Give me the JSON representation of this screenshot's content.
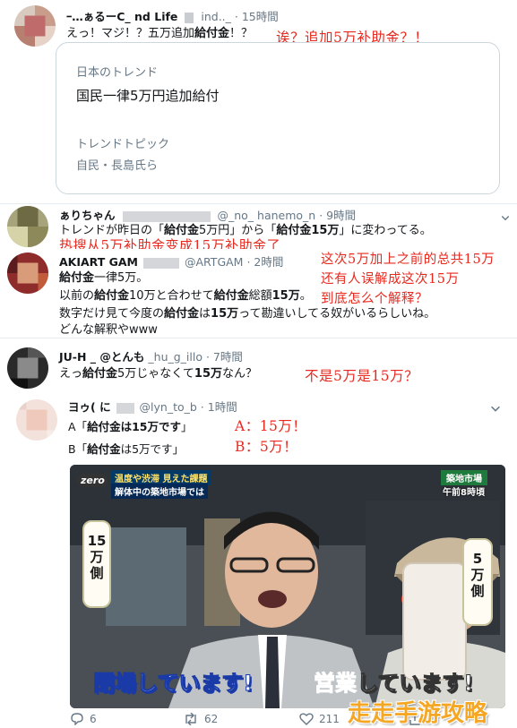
{
  "tweet1": {
    "username": "ｰ…ぁるーC_ nd Life",
    "handle": "ind.._",
    "time": "15時間",
    "text_prefix": "えっ！マジ！？五万追加",
    "text_bold": "給付金",
    "text_suffix": "！？",
    "note": "诶？追加5万补助金？！"
  },
  "trend_card": {
    "label": "日本のトレンド",
    "title": "国民一律5万円追加給付",
    "topic_label": "トレンドトピック",
    "topic_value": "自民・長島氏ら"
  },
  "tweet2": {
    "username": "ぁりちゃん",
    "handle": "@_no_ hanemo_n",
    "time": "9時間",
    "line1_a": "トレンドが昨日の「",
    "line1_b": "給付金",
    "line1_c": "5万円」から「",
    "line1_d": "給付金15万",
    "line1_e": "」に変わってる。",
    "note": "热搜从5万补助金变成15万补助金了"
  },
  "tweet3": {
    "username": "AKIART GAM",
    "handle": "@ARTGAM",
    "time": "2時間",
    "line1_bold": "給付金",
    "line1_rest": "一律5万。",
    "line2_a": "以前の",
    "line2_b": "給付金",
    "line2_c": "10万と合わせて",
    "line2_d": "給付金",
    "line2_e": "総額",
    "line2_f": "15万",
    "line2_g": "。",
    "line3_a": "数字だけ見て今度の",
    "line3_b": "給付金",
    "line3_c": "は",
    "line3_d": "15万",
    "line3_e": "って勘違いしてる奴がいるらしいね。",
    "line4": "どんな解釈やwww",
    "note1": "这次5万加上之前的总共15万",
    "note2": "还有人误解成这次15万",
    "note3": "到底怎么个解释？"
  },
  "tweet4": {
    "username": "JU-H _ @とんも",
    "handle": "_hu_g_illo",
    "time": "7時間",
    "text_a": "えっ",
    "text_b": "給付金",
    "text_c": "5万じゃなくて",
    "text_d": "15万",
    "text_e": "なん？",
    "note": "不是5万是15万？"
  },
  "tweet5": {
    "username": "ヨゥ( に",
    "handle": "@lyn_to_b",
    "time": "1時間",
    "line_a_prefix": "A「",
    "line_a_bold": "給付金は15万です",
    "line_a_suffix": "」",
    "line_b_prefix": "B「",
    "line_b_bold": "給付金",
    "line_b_suffix": "は5万です」",
    "note_a": "A：15万！",
    "note_b": "B：5万！",
    "actions": {
      "reply": "6",
      "retweet": "62",
      "like": "211"
    }
  },
  "tv_image": {
    "logo": "zero",
    "top_banner_1": "温度や渋滞 見えた課題",
    "top_banner_2": "解体中の築地市場では",
    "right_tag": "築地市場",
    "right_time": "午前8時頃",
    "sign_left": [
      "15",
      "万",
      "側"
    ],
    "sign_right": [
      "5",
      "万",
      "側"
    ],
    "caption_left": "閉場しています!",
    "caption_right_a": "営業",
    "caption_right_b": "しています!"
  },
  "watermark": "走走手游攻略",
  "colors": {
    "note_red": "#e8291f",
    "meta_gray": "#657786",
    "border": "#e6ecf0"
  }
}
